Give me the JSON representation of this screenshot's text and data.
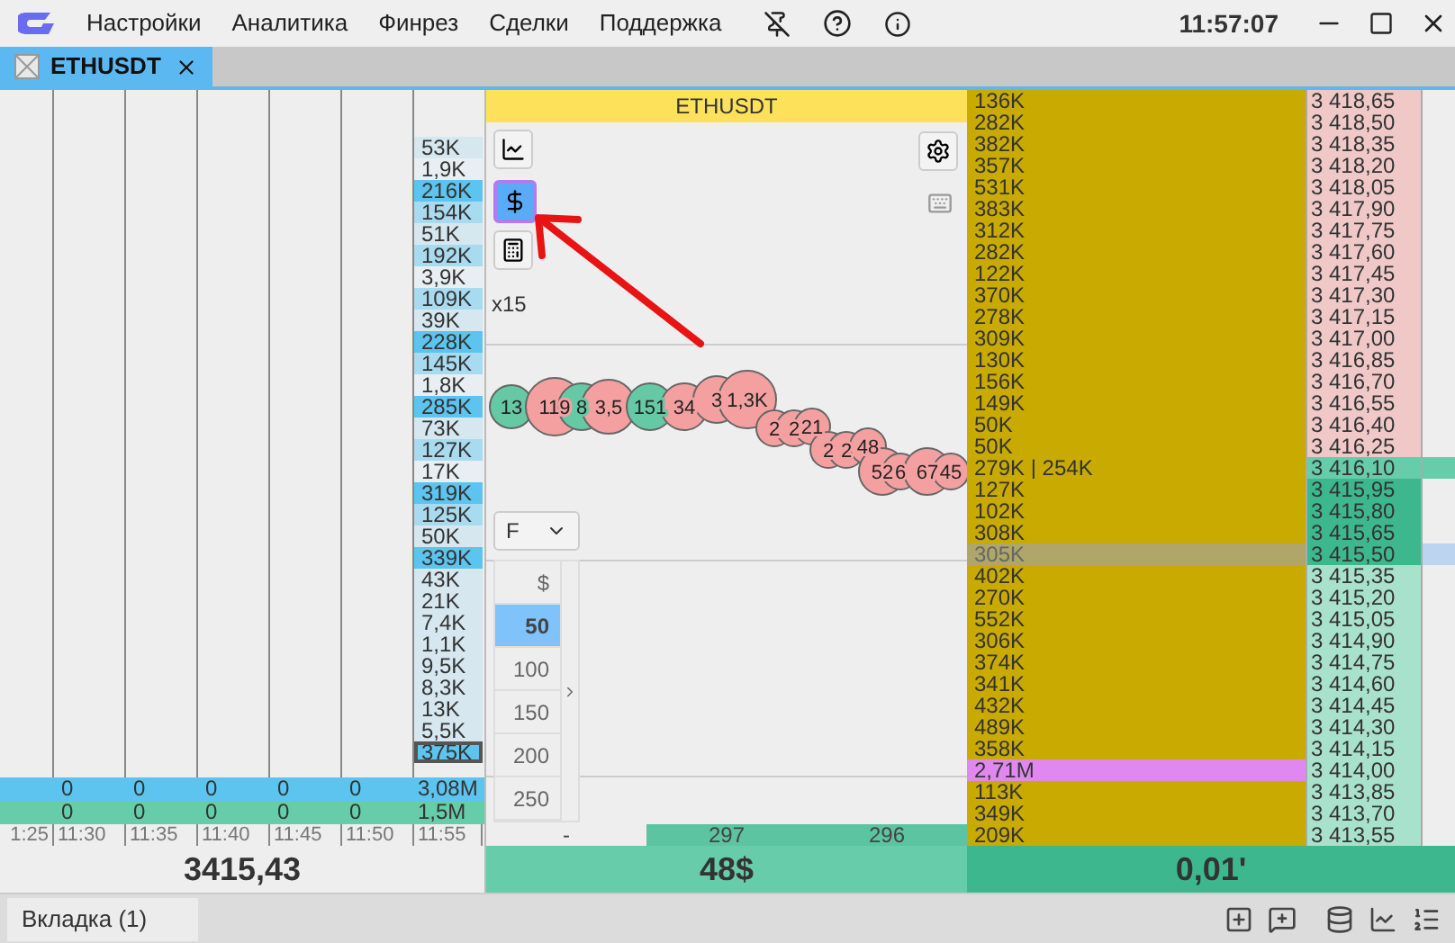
{
  "menu": [
    "Настройки",
    "Аналитика",
    "Финрез",
    "Сделки",
    "Поддержка"
  ],
  "clock": "11:57:07",
  "tabs": [
    {
      "label": "ETHUSDT",
      "selected": true
    }
  ],
  "cluster": {
    "volumes": [
      {
        "text": "53K",
        "kind": "low",
        "selected": false
      },
      {
        "text": "1,9K",
        "kind": "none",
        "selected": false
      },
      {
        "text": "216K",
        "kind": "high",
        "selected": false
      },
      {
        "text": "154K",
        "kind": "mid",
        "selected": false
      },
      {
        "text": "51K",
        "kind": "low",
        "selected": false
      },
      {
        "text": "192K",
        "kind": "mid",
        "selected": false
      },
      {
        "text": "3,9K",
        "kind": "none",
        "selected": false
      },
      {
        "text": "109K",
        "kind": "mid",
        "selected": false
      },
      {
        "text": "39K",
        "kind": "low",
        "selected": false
      },
      {
        "text": "228K",
        "kind": "high",
        "selected": false
      },
      {
        "text": "145K",
        "kind": "mid",
        "selected": false
      },
      {
        "text": "1,8K",
        "kind": "none",
        "selected": false
      },
      {
        "text": "285K",
        "kind": "high",
        "selected": false
      },
      {
        "text": "73K",
        "kind": "low",
        "selected": false
      },
      {
        "text": "127K",
        "kind": "mid",
        "selected": false
      },
      {
        "text": "17K",
        "kind": "none",
        "selected": false
      },
      {
        "text": "319K",
        "kind": "high",
        "selected": false
      },
      {
        "text": "125K",
        "kind": "mid",
        "selected": false
      },
      {
        "text": "50K",
        "kind": "low",
        "selected": false
      },
      {
        "text": "339K",
        "kind": "high",
        "selected": false
      },
      {
        "text": "43K",
        "kind": "low",
        "selected": false
      },
      {
        "text": "21K",
        "kind": "low",
        "selected": false
      },
      {
        "text": "7,4K",
        "kind": "low",
        "selected": false
      },
      {
        "text": "1,1K",
        "kind": "low",
        "selected": false
      },
      {
        "text": "9,5K",
        "kind": "low",
        "selected": false
      },
      {
        "text": "8,3K",
        "kind": "low",
        "selected": false
      },
      {
        "text": "13K",
        "kind": "low",
        "selected": false
      },
      {
        "text": "5,5K",
        "kind": "low",
        "selected": false
      },
      {
        "text": "375K",
        "kind": "high",
        "selected": true
      }
    ],
    "totals": [
      {
        "kind": "buy",
        "cells": [
          "0",
          "0",
          "0",
          "0",
          "0"
        ],
        "total": "3,08M"
      },
      {
        "kind": "sell",
        "cells": [
          "0",
          "0",
          "0",
          "0",
          "0"
        ],
        "total": "1,5M"
      }
    ],
    "times": [
      "1:25",
      "11:30",
      "11:35",
      "11:40",
      "11:45",
      "11:50",
      "11:55"
    ],
    "price": "3415,43"
  },
  "chart": {
    "title": "ETHUSDT",
    "multiplier": "x15",
    "currency_on": true,
    "bubbles": [
      {
        "label": "13",
        "kind": "buy"
      },
      {
        "label": "119",
        "kind": "sell"
      },
      {
        "label": "8",
        "kind": "buy"
      },
      {
        "label": "3,5",
        "kind": "sell"
      },
      {
        "label": "151",
        "kind": "buy"
      },
      {
        "label": "34",
        "kind": "sell"
      },
      {
        "label": "3",
        "kind": "sell"
      },
      {
        "label": "1,3K",
        "kind": "sell"
      },
      {
        "label": "2",
        "kind": "sell"
      },
      {
        "label": "2",
        "kind": "sell"
      },
      {
        "label": "21",
        "kind": "sell"
      },
      {
        "label": "2",
        "kind": "sell"
      },
      {
        "label": "2",
        "kind": "sell"
      },
      {
        "label": "48",
        "kind": "sell"
      },
      {
        "label": "52",
        "kind": "sell"
      },
      {
        "label": "6",
        "kind": "sell"
      },
      {
        "label": "67",
        "kind": "sell"
      },
      {
        "label": "45",
        "kind": "sell"
      }
    ],
    "filter": "F",
    "size_header": "$",
    "sizes": [
      {
        "label": "50",
        "selected": true
      },
      {
        "label": "100",
        "selected": false
      },
      {
        "label": "150",
        "selected": false
      },
      {
        "label": "200",
        "selected": false
      },
      {
        "label": "250",
        "selected": false
      }
    ],
    "footer": [
      "-",
      "297",
      "296"
    ],
    "total": "48$"
  },
  "ladder": {
    "rows": [
      {
        "volume": "136K",
        "price": "3 418,65",
        "kind": "ask",
        "selected": false,
        "highlighted": false
      },
      {
        "volume": "282K",
        "price": "3 418,50",
        "kind": "ask",
        "selected": false,
        "highlighted": false
      },
      {
        "volume": "382K",
        "price": "3 418,35",
        "kind": "ask",
        "selected": false,
        "highlighted": false
      },
      {
        "volume": "357K",
        "price": "3 418,20",
        "kind": "ask",
        "selected": false,
        "highlighted": false
      },
      {
        "volume": "531K",
        "price": "3 418,05",
        "kind": "ask",
        "selected": false,
        "highlighted": false
      },
      {
        "volume": "383K",
        "price": "3 417,90",
        "kind": "ask",
        "selected": false,
        "highlighted": false
      },
      {
        "volume": "312K",
        "price": "3 417,75",
        "kind": "ask",
        "selected": false,
        "highlighted": false
      },
      {
        "volume": "282K",
        "price": "3 417,60",
        "kind": "ask",
        "selected": false,
        "highlighted": false
      },
      {
        "volume": "122K",
        "price": "3 417,45",
        "kind": "ask",
        "selected": false,
        "highlighted": false
      },
      {
        "volume": "370K",
        "price": "3 417,30",
        "kind": "ask",
        "selected": false,
        "highlighted": false
      },
      {
        "volume": "278K",
        "price": "3 417,15",
        "kind": "ask",
        "selected": false,
        "highlighted": false
      },
      {
        "volume": "309K",
        "price": "3 417,00",
        "kind": "ask",
        "selected": false,
        "highlighted": false
      },
      {
        "volume": "130K",
        "price": "3 416,85",
        "kind": "ask",
        "selected": false,
        "highlighted": false
      },
      {
        "volume": "156K",
        "price": "3 416,70",
        "kind": "ask",
        "selected": false,
        "highlighted": false
      },
      {
        "volume": "149K",
        "price": "3 416,55",
        "kind": "ask",
        "selected": false,
        "highlighted": false
      },
      {
        "volume": "50K",
        "price": "3 416,40",
        "kind": "ask",
        "selected": false,
        "highlighted": false
      },
      {
        "volume": "50K",
        "price": "3 416,25",
        "kind": "ask",
        "selected": false,
        "highlighted": false
      },
      {
        "volume": "279K | 254K",
        "price": "3 416,10",
        "kind": "last",
        "selected": false,
        "highlighted": false
      },
      {
        "volume": "127K",
        "price": "3 415,95",
        "kind": "bid",
        "selected": false,
        "highlighted": false
      },
      {
        "volume": "102K",
        "price": "3 415,80",
        "kind": "bid",
        "selected": false,
        "highlighted": false
      },
      {
        "volume": "308K",
        "price": "3 415,65",
        "kind": "bid",
        "selected": false,
        "highlighted": false
      },
      {
        "volume": "305K",
        "price": "3 415,50",
        "kind": "bid",
        "selected": true,
        "highlighted": false
      },
      {
        "volume": "402K",
        "price": "3 415,35",
        "kind": "bid_far",
        "selected": false,
        "highlighted": false
      },
      {
        "volume": "270K",
        "price": "3 415,20",
        "kind": "bid_far",
        "selected": false,
        "highlighted": false
      },
      {
        "volume": "552K",
        "price": "3 415,05",
        "kind": "bid_far",
        "selected": false,
        "highlighted": false
      },
      {
        "volume": "306K",
        "price": "3 414,90",
        "kind": "bid_far",
        "selected": false,
        "highlighted": false
      },
      {
        "volume": "374K",
        "price": "3 414,75",
        "kind": "bid_far",
        "selected": false,
        "highlighted": false
      },
      {
        "volume": "341K",
        "price": "3 414,60",
        "kind": "bid_far",
        "selected": false,
        "highlighted": false
      },
      {
        "volume": "432K",
        "price": "3 414,45",
        "kind": "bid_far",
        "selected": false,
        "highlighted": false
      },
      {
        "volume": "489K",
        "price": "3 414,30",
        "kind": "bid_far",
        "selected": false,
        "highlighted": false
      },
      {
        "volume": "358K",
        "price": "3 414,15",
        "kind": "bid_far",
        "selected": false,
        "highlighted": false
      },
      {
        "volume": "2,71M",
        "price": "3 414,00",
        "kind": "bid_far",
        "selected": false,
        "highlighted": true
      },
      {
        "volume": "113K",
        "price": "3 413,85",
        "kind": "bid_far",
        "selected": false,
        "highlighted": false
      },
      {
        "volume": "349K",
        "price": "3 413,70",
        "kind": "bid_far",
        "selected": false,
        "highlighted": false
      },
      {
        "volume": "209K",
        "price": "3 413,55",
        "kind": "bid_far",
        "selected": false,
        "highlighted": false
      }
    ],
    "total": "0,01'"
  },
  "workspace_tabs": [
    {
      "label": "Вкладка (1)",
      "selected": true
    }
  ]
}
